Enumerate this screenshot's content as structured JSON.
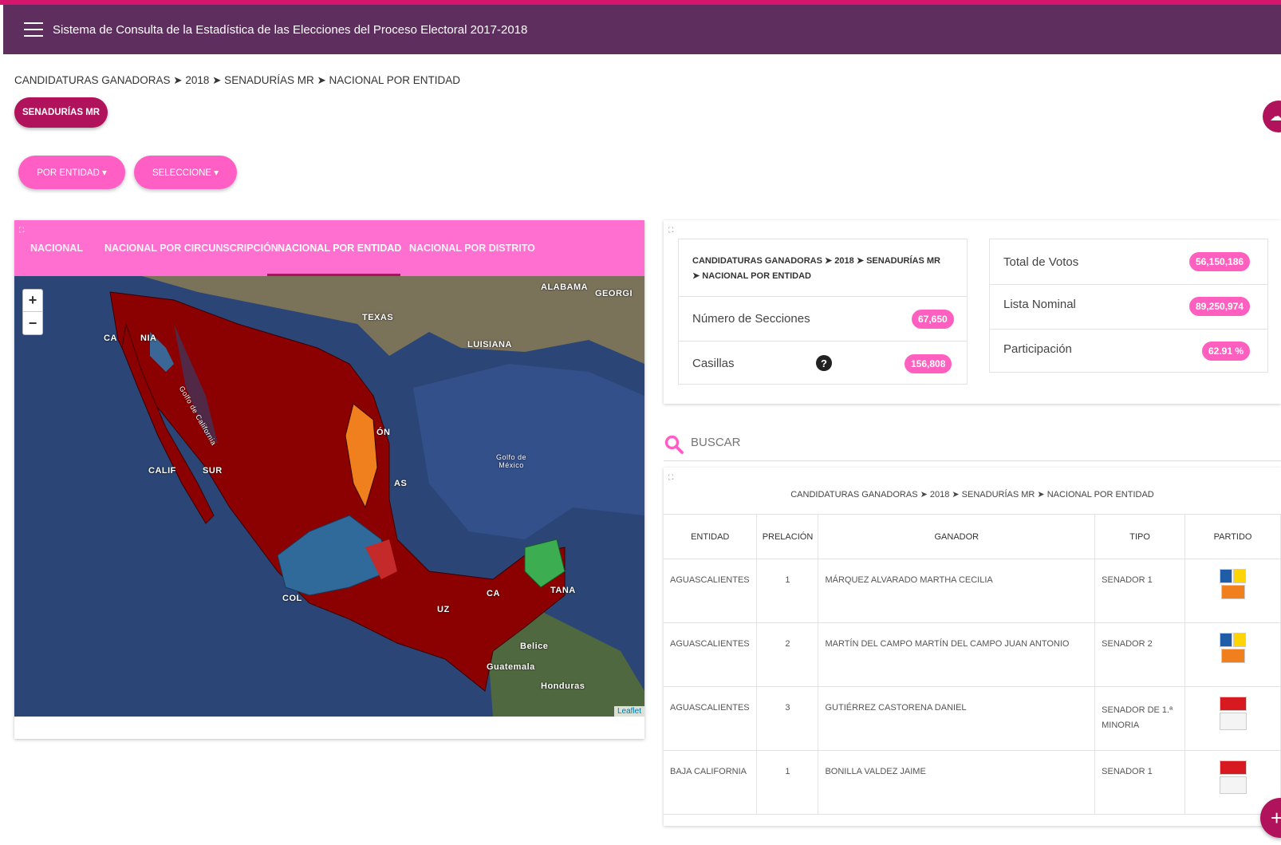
{
  "app": {
    "title": "Sistema de Consulta de la Estadística de las Elecciones del Proceso Electoral 2017-2018"
  },
  "breadcrumb": "CANDIDATURAS GANADORAS ➤ 2018 ➤ SENADURÍAS MR ➤ NACIONAL POR ENTIDAD",
  "election_type_pill": "SENADURÍAS MR",
  "filters": {
    "entity": "POR ENTIDAD ▾",
    "select": "SELECCIONE ▾"
  },
  "tabs": [
    {
      "label": "NACIONAL",
      "active": false
    },
    {
      "label": "NACIONAL POR CIRCUNSCRIPCIÓN",
      "active": false
    },
    {
      "label": "NACIONAL POR ENTIDAD",
      "active": true
    },
    {
      "label": "NACIONAL POR DISTRITO",
      "active": false
    }
  ],
  "map": {
    "zoom_in": "+",
    "zoom_out": "−",
    "attribution": "Leaflet",
    "labels": [
      "ALABAMA",
      "GEORGI",
      "TEXAS",
      "LUISIANA",
      "CA",
      "NIA",
      "Golfo de California",
      "CALIF",
      "SUR",
      "ÓN",
      "AS",
      "Golfo de México",
      "COL",
      "UZ",
      "CA",
      "TANA",
      "Belice",
      "Guatemala",
      "Honduras"
    ],
    "colors": {
      "morena": "#8b0000",
      "pan": "#2f6a9a",
      "mc": "#f07f1e",
      "pri": "#2fa84f",
      "other": "#b02030"
    }
  },
  "stats": {
    "breadcrumb": "CANDIDATURAS GANADORAS ➤ 2018 ➤ SENADURÍAS MR ➤ NACIONAL POR ENTIDAD",
    "secciones_label": "Número de Secciones",
    "secciones_value": "67,650",
    "casillas_label": "Casillas",
    "casillas_value": "156,808",
    "votos_label": "Total de Votos",
    "votos_value": "56,150,186",
    "lista_label": "Lista Nominal",
    "lista_value": "89,250,974",
    "participacion_label": "Participación",
    "participacion_value": "62.91 %"
  },
  "search": {
    "placeholder": "BUSCAR"
  },
  "table": {
    "title": "CANDIDATURAS GANADORAS ➤ 2018 ➤ SENADURÍAS MR ➤ NACIONAL POR ENTIDAD",
    "headers": [
      "ENTIDAD",
      "PRELACIÓN",
      "GANADOR",
      "TIPO",
      "PARTIDO"
    ],
    "rows": [
      {
        "entidad": "AGUASCALIENTES",
        "prelacion": "1",
        "ganador": "MÁRQUEZ ALVARADO MARTHA CECILIA",
        "tipo": "SENADOR 1",
        "partido": "PAN-PRD-MC"
      },
      {
        "entidad": "AGUASCALIENTES",
        "prelacion": "2",
        "ganador": "MARTÍN DEL CAMPO MARTÍN DEL CAMPO JUAN ANTONIO",
        "tipo": "SENADOR 2",
        "partido": "PAN-PRD-MC"
      },
      {
        "entidad": "AGUASCALIENTES",
        "prelacion": "3",
        "ganador": "GUTIÉRREZ CASTORENA DANIEL",
        "tipo": "SENADOR DE 1.ª MINORIA",
        "partido": "PT-MORENA-PES"
      },
      {
        "entidad": "BAJA CALIFORNIA",
        "prelacion": "1",
        "ganador": "BONILLA VALDEZ JAIME",
        "tipo": "SENADOR 1",
        "partido": "PT-MORENA-PES"
      }
    ]
  },
  "fab": "+"
}
